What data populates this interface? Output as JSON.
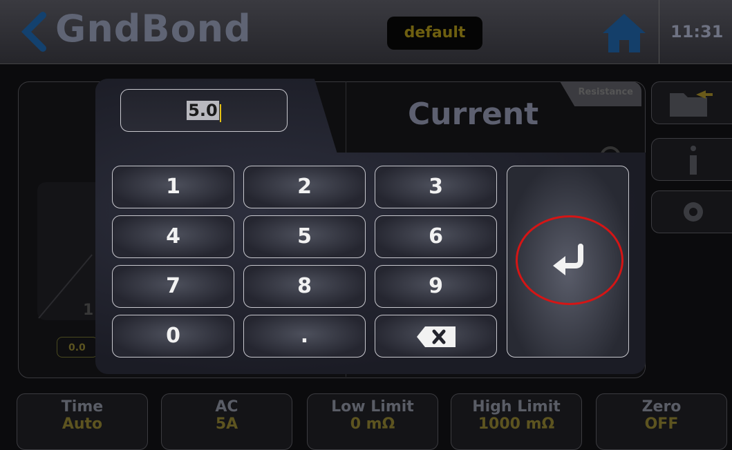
{
  "header": {
    "title": "GndBond",
    "profile": "default",
    "clock": "11:31"
  },
  "main": {
    "parameter_tab": "Resistance",
    "parameter_title": "Current",
    "graph_tick": "1",
    "graph_value": "0.0"
  },
  "keypad": {
    "value": "5.0",
    "keys": [
      "1",
      "2",
      "3",
      "4",
      "5",
      "6",
      "7",
      "8",
      "9",
      "0",
      "."
    ],
    "backspace_icon": "backspace-icon",
    "enter_icon": "enter-icon"
  },
  "bottom_tiles": [
    {
      "label": "Time",
      "value": "Auto"
    },
    {
      "label": "AC",
      "value": "5A"
    },
    {
      "label": "Low Limit",
      "value": "0 mΩ"
    },
    {
      "label": "High Limit",
      "value": "1000 mΩ"
    },
    {
      "label": "Zero",
      "value": "OFF"
    }
  ],
  "colors": {
    "highlight_ring": "#d51515",
    "accent_yellow": "#e6c214",
    "title_blue": "#1d6fd6"
  }
}
